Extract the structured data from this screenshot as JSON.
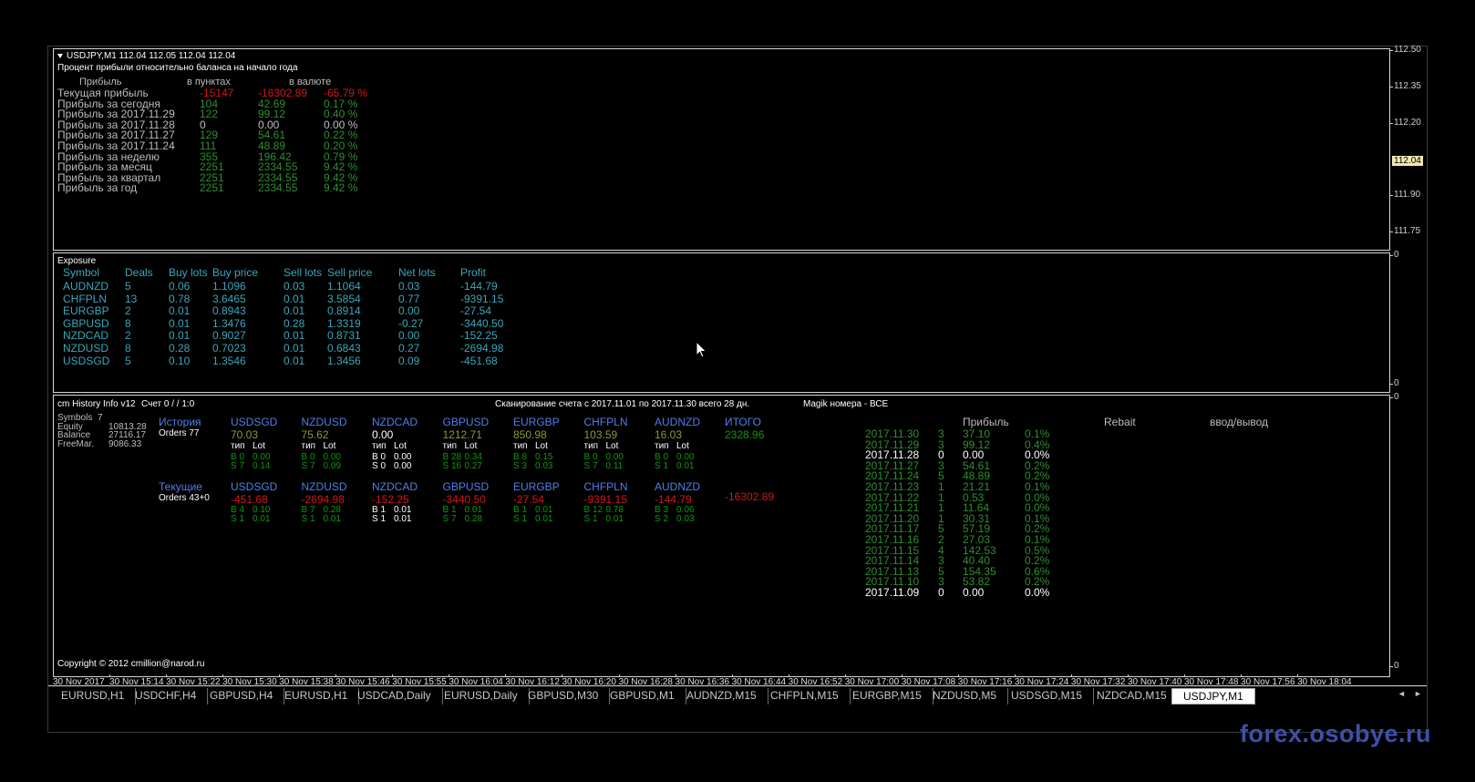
{
  "pane1": {
    "header": "USDJPY,M1  112.04 112.05 112.04 112.04",
    "subtitle": "Процент прибыли относительно баланса на начало года",
    "col_label": "Прибыль",
    "col_points": "в пунктах",
    "col_currency": "в валюте",
    "rows": [
      {
        "label": "Текущая прибыль",
        "points": "-15147",
        "money": "-16302.89",
        "pct": "-65.79 %",
        "neg": true
      },
      {
        "label": "Прибыль за сегодня",
        "points": "104",
        "money": "42.69",
        "pct": "0.17 %"
      },
      {
        "label": "Прибыль за 2017.11.29",
        "points": "122",
        "money": "99.12",
        "pct": "0.40 %"
      },
      {
        "label": "Прибыль за 2017.11.28",
        "points": "0",
        "money": "0.00",
        "pct": "0.00 %",
        "zero": true
      },
      {
        "label": "Прибыль за 2017.11.27",
        "points": "129",
        "money": "54.61",
        "pct": "0.22 %"
      },
      {
        "label": "Прибыль за 2017.11.24",
        "points": "111",
        "money": "48.89",
        "pct": "0.20 %"
      },
      {
        "label": "Прибыль за неделю",
        "points": "355",
        "money": "196.42",
        "pct": "0.79 %"
      },
      {
        "label": "Прибыль за месяц",
        "points": "2251",
        "money": "2334.55",
        "pct": "9.42 %"
      },
      {
        "label": "Прибыль за квартал",
        "points": "2251",
        "money": "2334.55",
        "pct": "9.42 %"
      },
      {
        "label": "Прибыль за год",
        "points": "2251",
        "money": "2334.55",
        "pct": "9.42 %"
      }
    ],
    "price_axis": [
      "112.50",
      "112.35",
      "112.20",
      "111.90",
      "111.75"
    ],
    "current_price": "112.04"
  },
  "pane2": {
    "title": "Exposure",
    "headers": [
      "Symbol",
      "Deals",
      "Buy lots",
      "Buy price",
      "Sell lots",
      "Sell price",
      "Net lots",
      "Profit"
    ],
    "rows": [
      [
        "AUDNZD",
        "5",
        "0.06",
        "1.1096",
        "0.03",
        "1.1064",
        "0.03",
        "-144.79"
      ],
      [
        "CHFPLN",
        "13",
        "0.78",
        "3.6465",
        "0.01",
        "3.5854",
        "0.77",
        "-9391.15"
      ],
      [
        "EURGBP",
        "2",
        "0.01",
        "0.8943",
        "0.01",
        "0.8914",
        "0.00",
        "-27.54"
      ],
      [
        "GBPUSD",
        "8",
        "0.01",
        "1.3476",
        "0.28",
        "1.3319",
        "-0.27",
        "-3440.50"
      ],
      [
        "NZDCAD",
        "2",
        "0.01",
        "0.9027",
        "0.01",
        "0.8731",
        "0.00",
        "-152.25"
      ],
      [
        "NZDUSD",
        "8",
        "0.28",
        "0.7023",
        "0.01",
        "0.6843",
        "0.27",
        "-2694.98"
      ],
      [
        "USDSGD",
        "5",
        "0.10",
        "1.3546",
        "0.01",
        "1.3456",
        "0.09",
        "-451.68"
      ]
    ],
    "axis_top": "0",
    "axis_bottom": "0"
  },
  "pane3": {
    "title": "cm History Info v12",
    "account": "Счет 0 /  / 1:0",
    "scan": "Сканирование счета с 2017.11.01 по 2017.11.30 всего 28 дн.",
    "magic": "Magik номера - ВСЕ",
    "stats": [
      {
        "label": "Symbols",
        "value": "7"
      },
      {
        "label": "Equity",
        "value": "10813.28"
      },
      {
        "label": "Balance",
        "value": "27116.17"
      },
      {
        "label": "FreeMar.",
        "value": "9086.33"
      }
    ],
    "history_label": "История",
    "history_orders": "Orders 77",
    "history": [
      {
        "sym": "USDSGD",
        "total": "70.03",
        "b": "B 0",
        "bl": "0.00",
        "s": "S 7",
        "sl": "0.14"
      },
      {
        "sym": "NZDUSD",
        "total": "75.62",
        "b": "B 0",
        "bl": "0.00",
        "s": "S 7",
        "sl": "0.09"
      },
      {
        "sym": "NZDCAD",
        "total": "0.00",
        "b": "B 0",
        "bl": "0.00",
        "s": "S 0",
        "sl": "0.00",
        "zero": true
      },
      {
        "sym": "GBPUSD",
        "total": "1212.71",
        "b": "B 28",
        "bl": "0.34",
        "s": "S 16",
        "sl": "0.27"
      },
      {
        "sym": "EURGBP",
        "total": "850.98",
        "b": "B 8",
        "bl": "0.15",
        "s": "S 3",
        "sl": "0.03"
      },
      {
        "sym": "CHFPLN",
        "total": "103.59",
        "b": "B 0",
        "bl": "0.00",
        "s": "S 7",
        "sl": "0.11"
      },
      {
        "sym": "AUDNZD",
        "total": "16.03",
        "b": "B 0",
        "bl": "0.00",
        "s": "S 1",
        "sl": "0.01"
      }
    ],
    "type_label": "тип",
    "lot_label": "Lot",
    "itogo_label": "ИТОГО",
    "itogo_value": "2328.96",
    "current_label": "Текущие",
    "current_orders": "Orders 43+0",
    "current": [
      {
        "sym": "USDSGD",
        "total": "-451.68",
        "b": "B 4",
        "bl": "0.10",
        "s": "S 1",
        "sl": "0.01"
      },
      {
        "sym": "NZDUSD",
        "total": "-2694.98",
        "b": "B 7",
        "bl": "0.28",
        "s": "S 1",
        "sl": "0.01"
      },
      {
        "sym": "NZDCAD",
        "total": "-152.25",
        "b": "B 1",
        "bl": "0.01",
        "s": "S 1",
        "sl": "0.01",
        "white": true
      },
      {
        "sym": "GBPUSD",
        "total": "-3440.50",
        "b": "B 1",
        "bl": "0.01",
        "s": "S 7",
        "sl": "0.28"
      },
      {
        "sym": "EURGBP",
        "total": "-27.54",
        "b": "B 1",
        "bl": "0.01",
        "s": "S 1",
        "sl": "0.01"
      },
      {
        "sym": "CHFPLN",
        "total": "-9391.15",
        "b": "B 12",
        "bl": "0.78",
        "s": "S 1",
        "sl": "0.01"
      },
      {
        "sym": "AUDNZD",
        "total": "-144.79",
        "b": "B 3",
        "bl": "0.06",
        "s": "S 2",
        "sl": "0.03"
      }
    ],
    "current_total": "-16302.89",
    "daily_header_profit": "Прибыль",
    "daily_header_rebate": "Rebait",
    "daily_header_io": "ввод/вывод",
    "daily": [
      {
        "date": "2017.11.30",
        "n": "3",
        "profit": "37.10",
        "pct": "0.1%"
      },
      {
        "date": "2017.11.29",
        "n": "3",
        "profit": "99.12",
        "pct": "0.4%"
      },
      {
        "date": "2017.11.28",
        "n": "0",
        "profit": "0.00",
        "pct": "0.0%",
        "zero": true
      },
      {
        "date": "2017.11.27",
        "n": "3",
        "profit": "54.61",
        "pct": "0.2%"
      },
      {
        "date": "2017.11.24",
        "n": "5",
        "profit": "48.89",
        "pct": "0.2%"
      },
      {
        "date": "2017.11.23",
        "n": "1",
        "profit": "21.21",
        "pct": "0.1%"
      },
      {
        "date": "2017.11.22",
        "n": "1",
        "profit": "0.53",
        "pct": "0.0%"
      },
      {
        "date": "2017.11.21",
        "n": "1",
        "profit": "11.64",
        "pct": "0.0%"
      },
      {
        "date": "2017.11.20",
        "n": "1",
        "profit": "30.31",
        "pct": "0.1%"
      },
      {
        "date": "2017.11.17",
        "n": "5",
        "profit": "57.19",
        "pct": "0.2%"
      },
      {
        "date": "2017.11.16",
        "n": "2",
        "profit": "27.03",
        "pct": "0.1%"
      },
      {
        "date": "2017.11.15",
        "n": "4",
        "profit": "142.53",
        "pct": "0.5%"
      },
      {
        "date": "2017.11.14",
        "n": "3",
        "profit": "40.40",
        "pct": "0.2%"
      },
      {
        "date": "2017.11.13",
        "n": "5",
        "profit": "154.35",
        "pct": "0.6%"
      },
      {
        "date": "2017.11.10",
        "n": "3",
        "profit": "53.82",
        "pct": "0.2%"
      },
      {
        "date": "2017.11.09",
        "n": "0",
        "profit": "0.00",
        "pct": "0.0%",
        "zero": true
      }
    ],
    "copyright": "Copyright © 2012 cmillion@narod.ru",
    "axis_top": "0",
    "axis_bottom": "0"
  },
  "time_axis": [
    "30 Nov 2017",
    "30 Nov 15:14",
    "30 Nov 15:22",
    "30 Nov 15:30",
    "30 Nov 15:38",
    "30 Nov 15:46",
    "30 Nov 15:55",
    "30 Nov 16:04",
    "30 Nov 16:12",
    "30 Nov 16:20",
    "30 Nov 16:28",
    "30 Nov 16:36",
    "30 Nov 16:44",
    "30 Nov 16:52",
    "30 Nov 17:00",
    "30 Nov 17:08",
    "30 Nov 17:16",
    "30 Nov 17:24",
    "30 Nov 17:32",
    "30 Nov 17:40",
    "30 Nov 17:48",
    "30 Nov 17:56",
    "30 Nov 18:04"
  ],
  "tabs": [
    "EURUSD,H1",
    "USDCHF,H4",
    "GBPUSD,H4",
    "EURUSD,H1",
    "USDCAD,Daily",
    "EURUSD,Daily",
    "GBPUSD,M30",
    "GBPUSD,M1",
    "AUDNZD,M15",
    "CHFPLN,M15",
    "EURGBP,M15",
    "NZDUSD,M5",
    "USDSGD,M15",
    "NZDCAD,M15",
    "USDJPY,M1"
  ],
  "active_tab": 14,
  "nav_left": "◄",
  "nav_right": "►",
  "watermark": "forex.osobye.ru",
  "colors": {
    "profit": "#0a9a0a",
    "loss": "#d01818",
    "symbol": "#4f7fe6",
    "exposure": "#3aa6b9"
  }
}
